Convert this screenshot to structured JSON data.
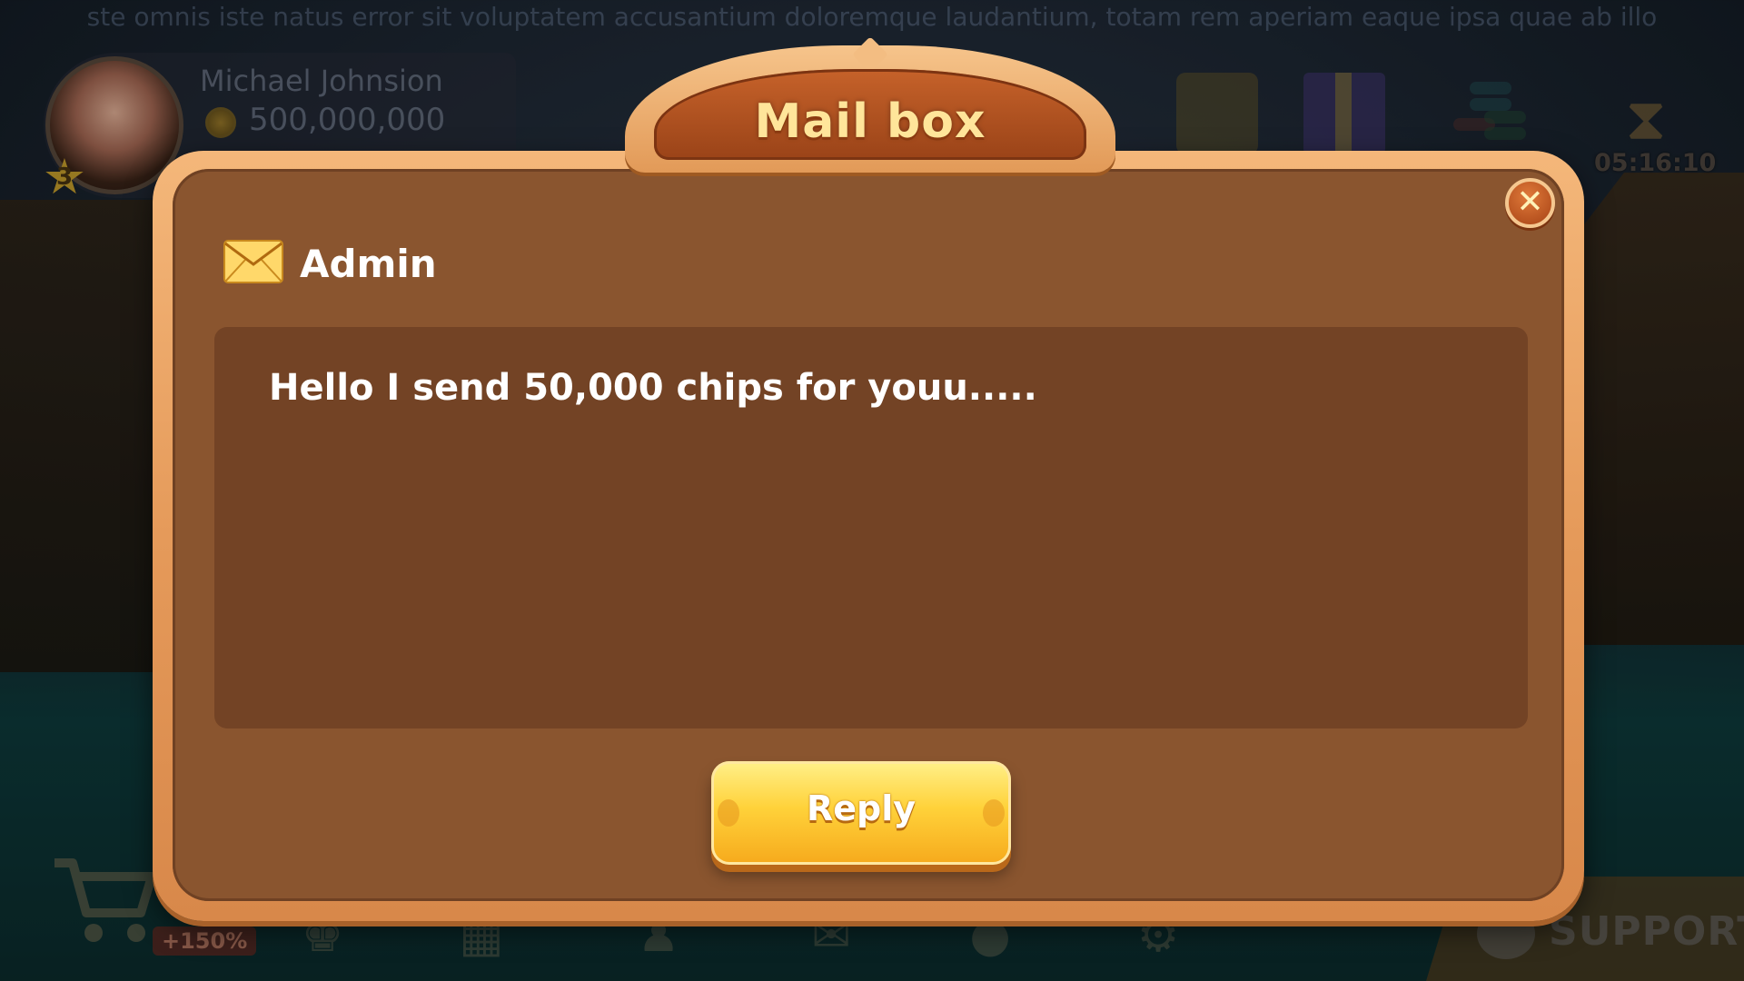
{
  "background": {
    "ticker_text": "ste omnis iste natus error sit voluptatem accusantium doloremque laudantium, totam rem aperiam eaque ipsa quae ab illo",
    "player": {
      "name": "Michael Johnsion",
      "coins": "500,000,000",
      "level": "3"
    },
    "timer": "05:16:10",
    "discount_badge": "+150%",
    "support_label": "SUPPORT"
  },
  "modal": {
    "title": "Mail box",
    "close_label": "✕",
    "sender": "Admin",
    "message": "Hello I send 50,000 chips for youu.....",
    "reply_label": "Reply"
  },
  "colors": {
    "frame": "#e59a5a",
    "panel": "#8a552f",
    "message_bg": "#734325",
    "title_text": "#ffe59a",
    "button": "#ffd23a"
  }
}
